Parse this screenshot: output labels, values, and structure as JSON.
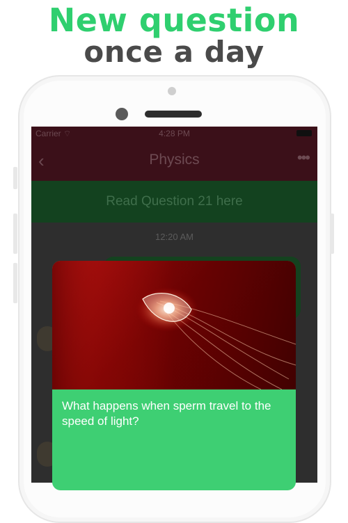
{
  "promo": {
    "line1": "New question",
    "line2": "once a day"
  },
  "status_bar": {
    "carrier": "Carrier ⌔",
    "time": "4:28 PM"
  },
  "nav": {
    "back_icon": "‹",
    "title": "Physics",
    "more_icon": "•••"
  },
  "banner": {
    "label": "Read Question 21 here"
  },
  "chat": {
    "timestamp": "12:20 AM"
  },
  "card": {
    "question": "What happens when sperm travel to the speed of light?"
  },
  "colors": {
    "accent_green": "#3ecf73",
    "headline_green": "#2fcf6f",
    "nav_dim": "#3b1019"
  }
}
